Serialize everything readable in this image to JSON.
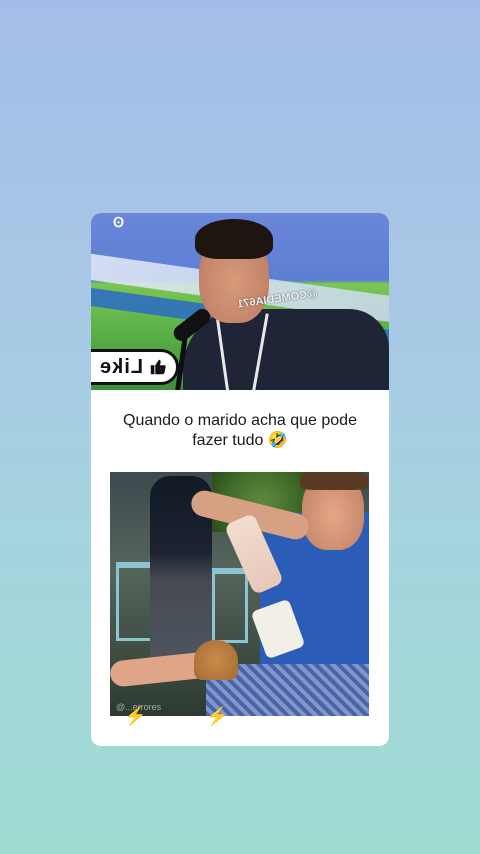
{
  "card": {
    "top_video": {
      "logo_text": "Ꙩ",
      "watermark": "@COMEDIA671",
      "like_button": {
        "label": "Like",
        "icon": "thumbs-up-icon"
      }
    },
    "caption": "Quando o marido acha que pode fazer tudo 🤣",
    "bottom_video": {
      "handle": "@...errores"
    },
    "footer_icons": [
      "⚡",
      "⚡"
    ]
  },
  "colors": {
    "background_top": "#a3bde8",
    "background_bottom": "#9fdcd2",
    "card": "#ffffff",
    "bolt": "#f2c012"
  }
}
